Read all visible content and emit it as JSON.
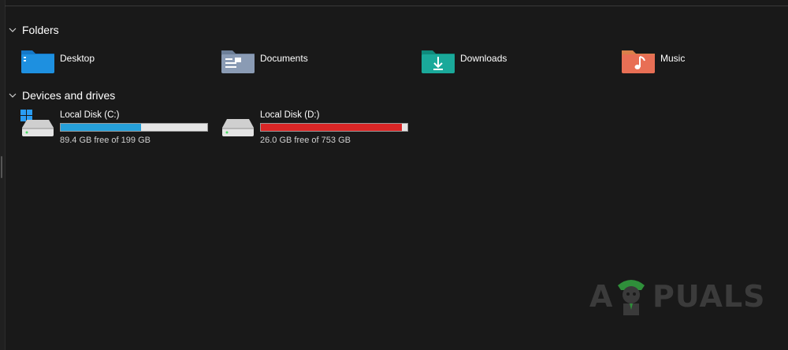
{
  "sections": {
    "folders": {
      "title": "Folders",
      "items": [
        {
          "label": "Desktop",
          "icon": "desktop-folder-icon"
        },
        {
          "label": "Documents",
          "icon": "documents-folder-icon"
        },
        {
          "label": "Downloads",
          "icon": "downloads-folder-icon"
        },
        {
          "label": "Music",
          "icon": "music-folder-icon"
        }
      ]
    },
    "drives": {
      "title": "Devices and drives",
      "items": [
        {
          "label": "Local Disk (C:)",
          "free_text": "89.4 GB free of 199 GB",
          "used_fraction": 0.55,
          "bar_color": "#26a0da",
          "icon": "windows-drive-icon"
        },
        {
          "label": "Local Disk (D:)",
          "free_text": "26.0 GB free of 753 GB",
          "used_fraction": 0.965,
          "bar_color": "#da2626",
          "icon": "hard-drive-icon"
        }
      ]
    }
  },
  "watermark": {
    "text_left": "A",
    "text_right": "PUALS"
  },
  "colors": {
    "background": "#191919",
    "desktop_folder": "#1e90e0",
    "documents_folder": "#8a9bb4",
    "downloads_folder": "#1aa99a",
    "music_folder": "#e86f55"
  }
}
